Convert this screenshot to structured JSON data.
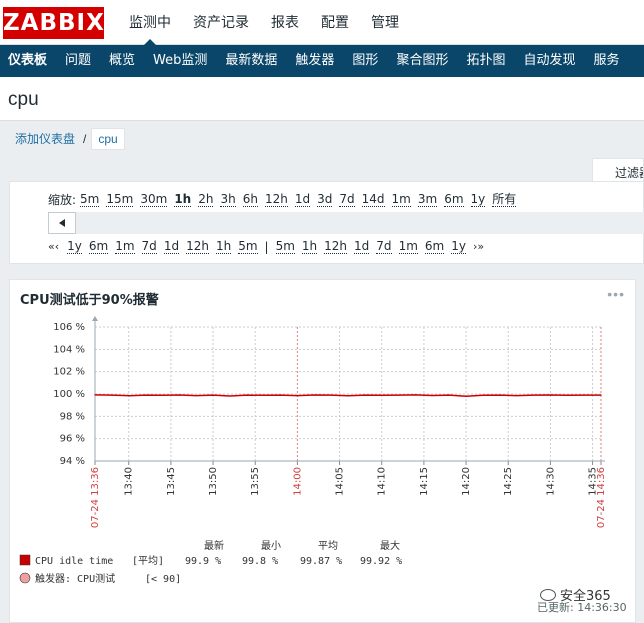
{
  "header": {
    "logo": "ZABBIX",
    "menu": [
      {
        "label": "监测中",
        "active": true
      },
      {
        "label": "资产记录",
        "active": false
      },
      {
        "label": "报表",
        "active": false
      },
      {
        "label": "配置",
        "active": false
      },
      {
        "label": "管理",
        "active": false
      }
    ]
  },
  "submenu": [
    {
      "label": "仪表板",
      "active": true
    },
    {
      "label": "问题"
    },
    {
      "label": "概览"
    },
    {
      "label": "Web监测"
    },
    {
      "label": "最新数据"
    },
    {
      "label": "触发器"
    },
    {
      "label": "图形"
    },
    {
      "label": "聚合图形"
    },
    {
      "label": "拓扑图"
    },
    {
      "label": "自动发现"
    },
    {
      "label": "服务"
    }
  ],
  "page": {
    "title": "cpu",
    "breadcrumb": {
      "parent": "添加仪表盘",
      "separator": "/",
      "current": "cpu"
    },
    "filter_tab": "过滤器"
  },
  "time_selector": {
    "zoom_label": "缩放:",
    "zoom_options": [
      "5m",
      "15m",
      "30m",
      "1h",
      "2h",
      "3h",
      "6h",
      "12h",
      "1d",
      "3d",
      "7d",
      "14d",
      "1m",
      "3m",
      "6m",
      "1y",
      "所有"
    ],
    "zoom_selected": "1h",
    "nav_back_arrow": "«‹",
    "nav_back": [
      "1y",
      "6m",
      "1m",
      "7d",
      "1d",
      "12h",
      "1h",
      "5m"
    ],
    "nav_separator": "|",
    "nav_forward": [
      "5m",
      "1h",
      "12h",
      "1d",
      "7d",
      "1m",
      "6m",
      "1y"
    ],
    "nav_forward_arrow": "›»"
  },
  "widget": {
    "title": "CPU测试低于90%报警",
    "menu_icon": "more-dots-icon"
  },
  "chart_data": {
    "type": "line",
    "title": "CPU测试低于90%报警",
    "ylim": [
      94,
      106
    ],
    "y_ticks": [
      {
        "value": 106,
        "label": "106 %"
      },
      {
        "value": 104,
        "label": "104 %"
      },
      {
        "value": 102,
        "label": "102 %"
      },
      {
        "value": 100,
        "label": "100 %"
      },
      {
        "value": 98,
        "label": "98 %"
      },
      {
        "value": 96,
        "label": "96 %"
      },
      {
        "value": 94,
        "label": "94 %"
      }
    ],
    "x_range": [
      "13:36",
      "14:36"
    ],
    "x_ticks": [
      {
        "minute": 0,
        "label": "07-24 13:36",
        "highlight": true
      },
      {
        "minute": 4,
        "label": "13:40",
        "highlight": false
      },
      {
        "minute": 9,
        "label": "13:45",
        "highlight": false
      },
      {
        "minute": 14,
        "label": "13:50",
        "highlight": false
      },
      {
        "minute": 19,
        "label": "13:55",
        "highlight": false
      },
      {
        "minute": 24,
        "label": "14:00",
        "highlight": true
      },
      {
        "minute": 29,
        "label": "14:05",
        "highlight": false
      },
      {
        "minute": 34,
        "label": "14:10",
        "highlight": false
      },
      {
        "minute": 39,
        "label": "14:15",
        "highlight": false
      },
      {
        "minute": 44,
        "label": "14:20",
        "highlight": false
      },
      {
        "minute": 49,
        "label": "14:25",
        "highlight": false
      },
      {
        "minute": 54,
        "label": "14:30",
        "highlight": false
      },
      {
        "minute": 59,
        "label": "14:35",
        "highlight": false
      },
      {
        "minute": 60,
        "label": "07-24 14:36",
        "highlight": true
      }
    ],
    "grid": true,
    "series": [
      {
        "name": "CPU idle time",
        "color": "#c80000",
        "x": [
          0,
          2,
          4,
          6,
          8,
          10,
          12,
          14,
          16,
          18,
          20,
          22,
          24,
          26,
          28,
          30,
          32,
          34,
          36,
          38,
          40,
          42,
          44,
          46,
          48,
          50,
          52,
          54,
          56,
          58,
          60
        ],
        "values": [
          99.92,
          99.9,
          99.85,
          99.9,
          99.88,
          99.91,
          99.86,
          99.9,
          99.82,
          99.9,
          99.88,
          99.9,
          99.86,
          99.91,
          99.9,
          99.84,
          99.9,
          99.88,
          99.9,
          99.92,
          99.87,
          99.9,
          99.8,
          99.88,
          99.9,
          99.86,
          99.9,
          99.91,
          99.88,
          99.9,
          99.9
        ]
      }
    ],
    "legend_header": {
      "last": "最新",
      "min": "最小",
      "avg": "平均",
      "max": "最大"
    },
    "legend": {
      "name": "CPU idle time",
      "func": "[平均]",
      "last": "99.9 %",
      "min": "99.8 %",
      "avg": "99.87 %",
      "max": "99.92 %"
    },
    "trigger": {
      "label": "触发器: CPU测试",
      "condition": "[< 90]",
      "color": "#f0a0a0"
    }
  },
  "footer": {
    "watermark": "安全365",
    "updated": "已更新: 14:36:30"
  }
}
